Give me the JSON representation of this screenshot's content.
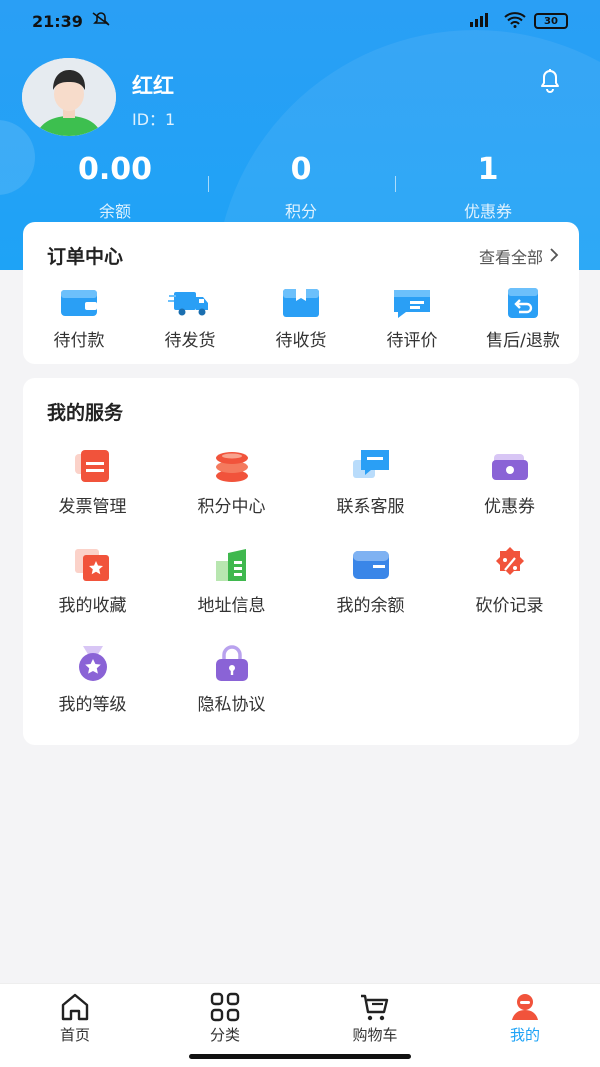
{
  "status_bar": {
    "time": "21:39",
    "battery": "30"
  },
  "profile": {
    "name": "红红",
    "id_text": "ID：1"
  },
  "stats": [
    {
      "value": "0.00",
      "label": "余额"
    },
    {
      "value": "0",
      "label": "积分"
    },
    {
      "value": "1",
      "label": "优惠券"
    }
  ],
  "orders": {
    "title": "订单中心",
    "see_all": "查看全部",
    "items": [
      {
        "label": "待付款",
        "icon": "wallet-icon"
      },
      {
        "label": "待发货",
        "icon": "truck-icon"
      },
      {
        "label": "待收货",
        "icon": "box-icon"
      },
      {
        "label": "待评价",
        "icon": "comment-icon"
      },
      {
        "label": "售后/退款",
        "icon": "return-icon"
      }
    ]
  },
  "services": {
    "title": "我的服务",
    "items": [
      {
        "label": "发票管理",
        "icon": "invoice-icon"
      },
      {
        "label": "积分中心",
        "icon": "coins-icon"
      },
      {
        "label": "联系客服",
        "icon": "chat-icon"
      },
      {
        "label": "优惠券",
        "icon": "coupon-icon"
      },
      {
        "label": "我的收藏",
        "icon": "favorite-icon"
      },
      {
        "label": "地址信息",
        "icon": "building-icon"
      },
      {
        "label": "我的余额",
        "icon": "card-icon"
      },
      {
        "label": "砍价记录",
        "icon": "discount-badge-icon"
      },
      {
        "label": "我的等级",
        "icon": "medal-icon"
      },
      {
        "label": "隐私协议",
        "icon": "lock-icon"
      }
    ]
  },
  "tabbar": [
    {
      "label": "首页",
      "icon": "home-icon"
    },
    {
      "label": "分类",
      "icon": "grid-icon"
    },
    {
      "label": "购物车",
      "icon": "cart-icon"
    },
    {
      "label": "我的",
      "icon": "user-icon",
      "active": true
    }
  ],
  "colors": {
    "primary": "#1ea3f6",
    "header": "#2a9ff5",
    "background": "#f4f4f6"
  }
}
